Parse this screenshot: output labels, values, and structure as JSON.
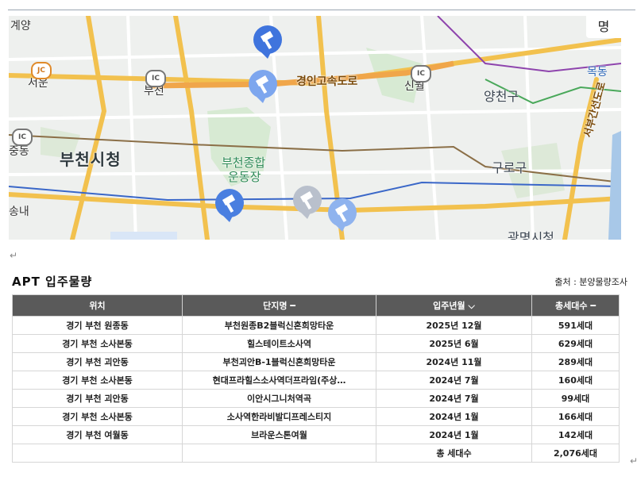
{
  "map": {
    "labels": {
      "gyeyang": "계양",
      "seoun": "서운",
      "bucheon_ic": "부천",
      "gyeongin": "경인고속도로",
      "sinwol": "신월",
      "yangcheon": "양천구",
      "mokdong": "목동",
      "jungdong": "중동",
      "bucheon_city": "부천시청",
      "stadium1": "부천종합",
      "stadium2": "운동장",
      "guro": "구로구",
      "seobu": "서부간선도로",
      "songnae": "송내",
      "gwangmyeong": "광명시청",
      "corner": "명"
    },
    "badges": {
      "jc": "JC",
      "ic1": "IC",
      "ic2": "IC",
      "ic3": "IC"
    },
    "colors": {
      "pin_blue": "#4a7fe0",
      "pin_light": "#8fb3ee",
      "pin_gray": "#b9c0cc",
      "highway": "#f2c14e",
      "river": "#a8c8e8"
    }
  },
  "return_mark": "↵",
  "section": {
    "title": "APT 입주물량",
    "source": "출처 : 분양물량조사"
  },
  "table": {
    "headers": [
      "위치",
      "단지명 ━",
      "입주년월 ⌵",
      "총세대수 ━"
    ],
    "rows": [
      [
        "경기 부천 원종동",
        "부천원종B2블럭신혼희망타운",
        "2025년 12월",
        "591세대"
      ],
      [
        "경기 부천 소사본동",
        "힐스테이트소사역",
        "2025년 6월",
        "629세대"
      ],
      [
        "경기 부천 괴안동",
        "부천괴안B-1블럭신혼희망타운",
        "2024년 11월",
        "289세대"
      ],
      [
        "경기 부천 소사본동",
        "현대프라힐스소사역더프라임(주상…",
        "2024년 7월",
        "160세대"
      ],
      [
        "경기 부천 괴안동",
        "이안시그니처역곡",
        "2024년 7월",
        "99세대"
      ],
      [
        "경기 부천 소사본동",
        "소사역한라비발디프레스티지",
        "2024년 1월",
        "166세대"
      ],
      [
        "경기 부천 여월동",
        "브라운스톤여월",
        "2024년 1월",
        "142세대"
      ]
    ],
    "total": {
      "label": "총 세대수",
      "value": "2,076세대"
    }
  }
}
